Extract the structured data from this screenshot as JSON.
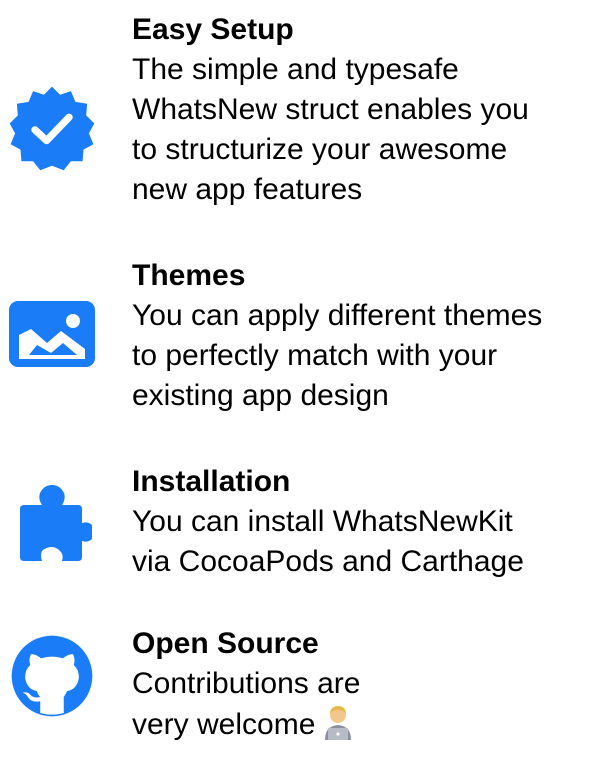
{
  "accent_color": "#1A7CF7",
  "features": [
    {
      "icon": "checkmark-seal-icon",
      "title": "Easy Setup",
      "subtitle": "The simple and typesafe\nWhatsNew struct enables you\nto structurize your awesome\nnew app features"
    },
    {
      "icon": "photo-icon",
      "title": "Themes",
      "subtitle": "You can apply different themes\nto perfectly match with your\nexisting app design"
    },
    {
      "icon": "puzzle-piece-icon",
      "title": "Installation",
      "subtitle": "You can install WhatsNewKit\nvia CocoaPods and Carthage"
    },
    {
      "icon": "github-octocat-icon",
      "title": "Open Source",
      "subtitle": "Contributions are\nvery welcome",
      "trailing_emoji": "technologist-emoji"
    }
  ]
}
